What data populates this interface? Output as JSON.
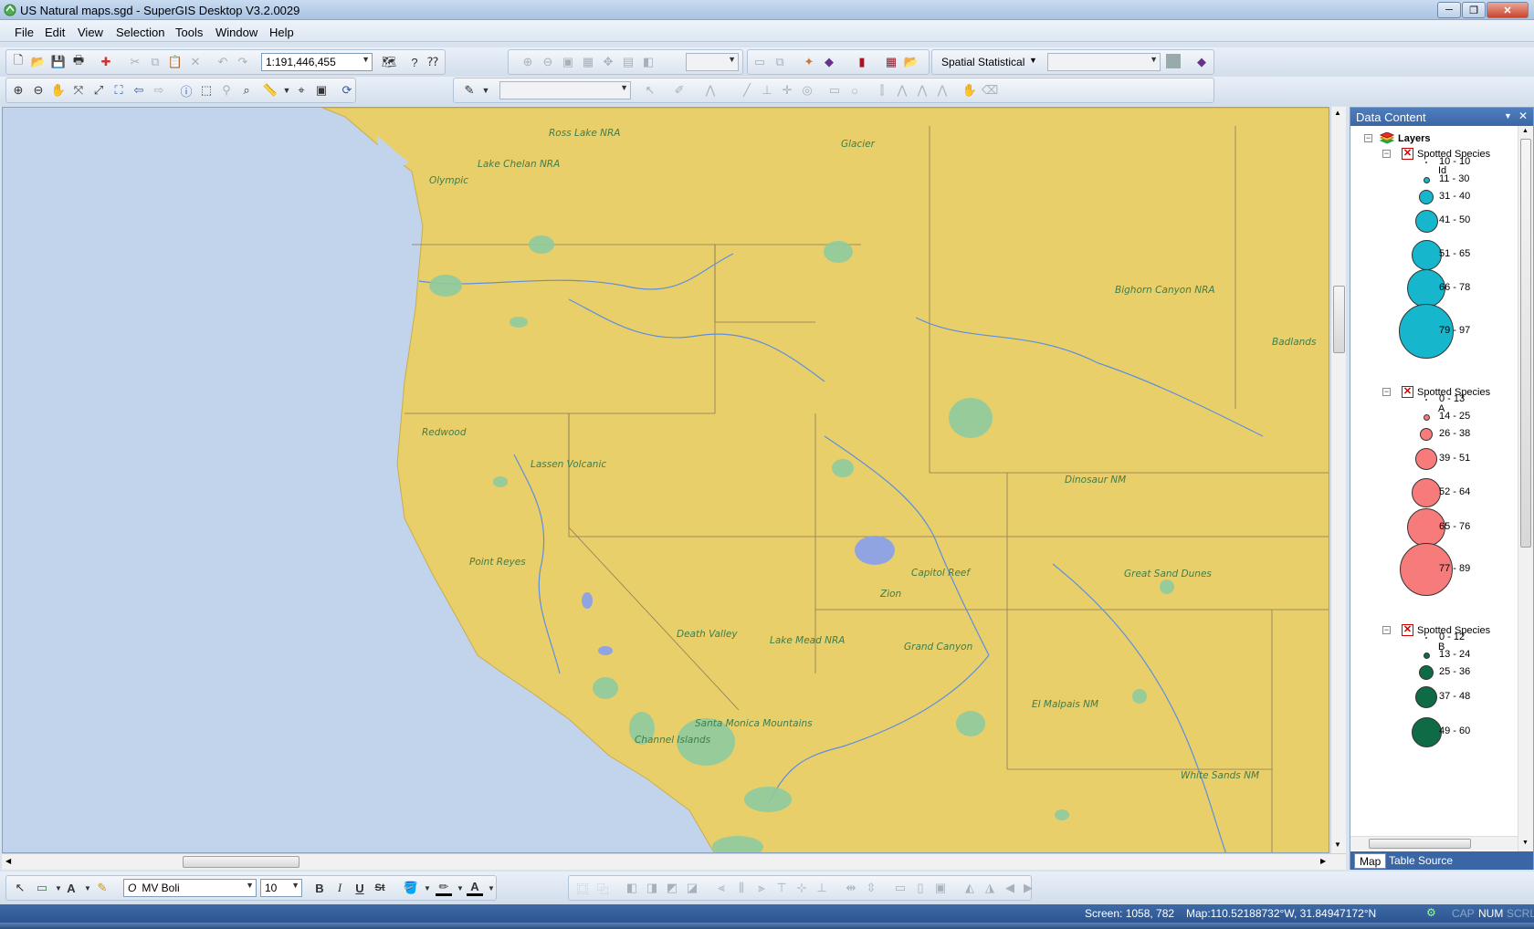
{
  "window": {
    "title": "US Natural maps.sgd - SuperGIS Desktop V3.2.0029",
    "minimize": "─",
    "restore": "❐",
    "close": "✕"
  },
  "menu": [
    "File",
    "Edit",
    "View",
    "Selection",
    "Tools",
    "Window",
    "Help"
  ],
  "toolbar": {
    "scale": "1:191,446,455",
    "spatial_statistical": "Spatial Statistical",
    "zoom_combo": "",
    "stat_combo": "",
    "layer_combo": ""
  },
  "map": {
    "labels": [
      "Ross Lake NRA",
      "Glacier",
      "Lake Chelan NRA",
      "Olympic",
      "Bighorn Canyon NRA",
      "Badlands",
      "Redwood",
      "Lassen Volcanic",
      "Dinosaur NM",
      "Point Reyes",
      "Capitol Reef",
      "Great Sand Dunes",
      "Zion",
      "Death Valley",
      "Lake Mead NRA",
      "Grand Canyon",
      "El Malpais NM",
      "Santa Monica Mountains",
      "Channel Islands",
      "White Sands NM"
    ],
    "colors": {
      "ocean": "#c1d4ec",
      "land": "#e8cf6a",
      "park": "#8fcaa0",
      "water": "#8fa4e0"
    }
  },
  "panel": {
    "title": "Data Content",
    "root": "Layers",
    "layers": [
      {
        "name": "Spotted Species",
        "field": "Id",
        "color": "#16b6cc",
        "classes": [
          "10 - 10",
          "11 - 30",
          "31 - 40",
          "41 - 50",
          "51 - 65",
          "66 - 78",
          "79 - 97"
        ]
      },
      {
        "name": "Spotted Species",
        "field": "A",
        "color": "#f77b7b",
        "classes": [
          "0 - 13",
          "14 - 25",
          "26 - 38",
          "39 - 51",
          "52 - 64",
          "65 - 76",
          "77 - 89"
        ]
      },
      {
        "name": "Spotted Species",
        "field": "B",
        "color": "#0f6b45",
        "classes": [
          "0 - 12",
          "13 - 24",
          "25 - 36",
          "37 - 48",
          "49 - 60"
        ]
      }
    ],
    "tabs": [
      "Map",
      "Table Source"
    ]
  },
  "drawing": {
    "font": "MV Boli",
    "size": "10",
    "bold": "B",
    "italic": "I",
    "underline": "U",
    "strike": "St"
  },
  "status": {
    "screen": "Screen: 1058, 782",
    "map": "Map:110.52188732°W, 31.84947172°N",
    "cap": "CAP",
    "num": "NUM",
    "scrl": "SCRL"
  }
}
